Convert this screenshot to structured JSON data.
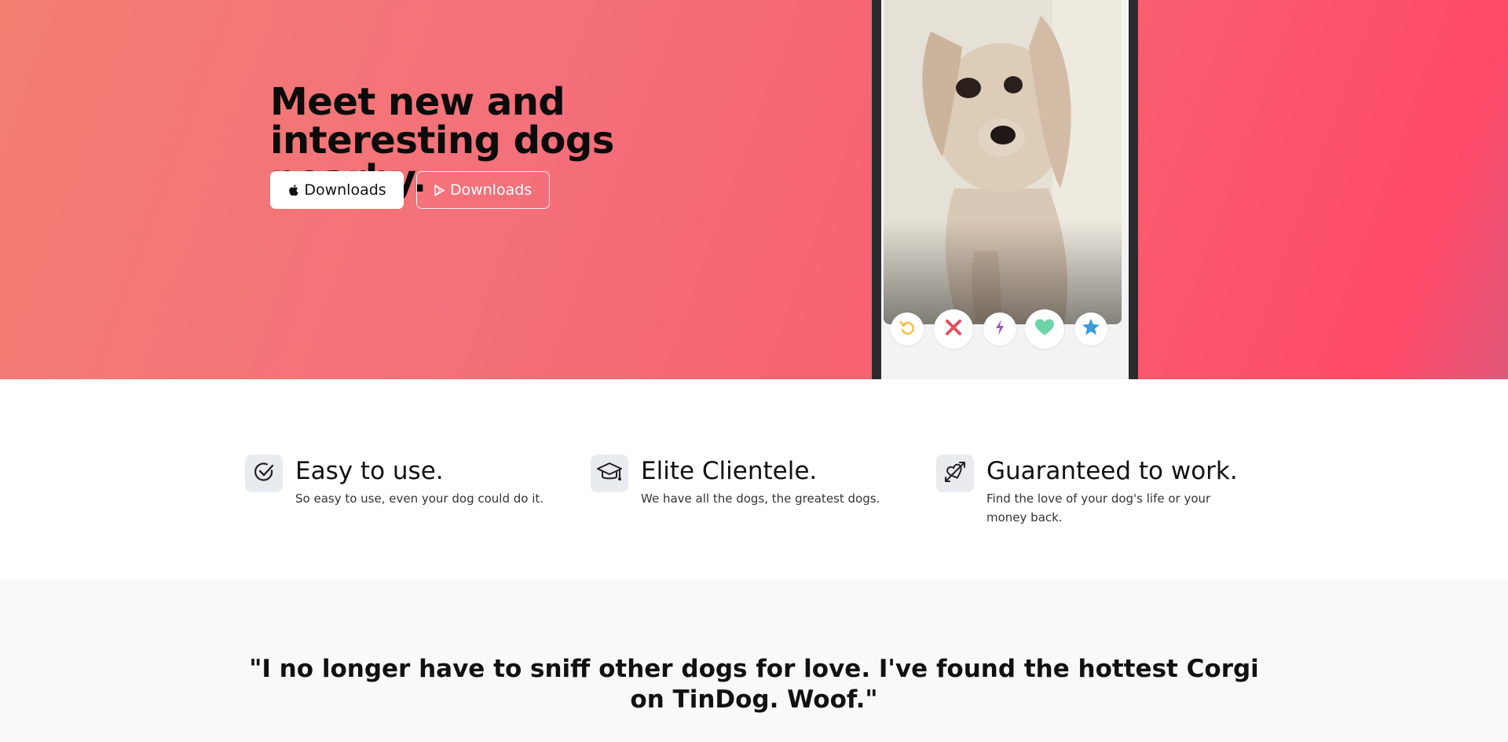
{
  "hero": {
    "title": "Meet new and interesting dogs nearby.",
    "apple_button_label": "Downloads",
    "play_button_label": "Downloads",
    "gradient_colors": [
      "#f27e72",
      "#ff4a68"
    ]
  },
  "phone": {
    "action_buttons": [
      {
        "name": "rewind",
        "icon": "undo-icon",
        "color": "#f5c24a"
      },
      {
        "name": "nope",
        "icon": "close-icon",
        "color": "#e2505f"
      },
      {
        "name": "boost",
        "icon": "lightning-icon",
        "color": "#9b59b6"
      },
      {
        "name": "like",
        "icon": "heart-icon",
        "color": "#6fd3a8"
      },
      {
        "name": "super-like",
        "icon": "star-icon",
        "color": "#3b9be0"
      }
    ]
  },
  "features": [
    {
      "icon": "check-circle-icon",
      "title": "Easy to use.",
      "text": "So easy to use, even your dog could do it."
    },
    {
      "icon": "graduation-cap-icon",
      "title": "Elite Clientele.",
      "text": "We have all the dogs, the greatest dogs."
    },
    {
      "icon": "heart-arrow-icon",
      "title": "Guaranteed to work.",
      "text": "Find the love of your dog's life or your money back."
    }
  ],
  "testimonial": {
    "quote": "\"I no longer have to sniff other dogs for love. I've found the hottest Corgi on TinDog. Woof.\""
  }
}
